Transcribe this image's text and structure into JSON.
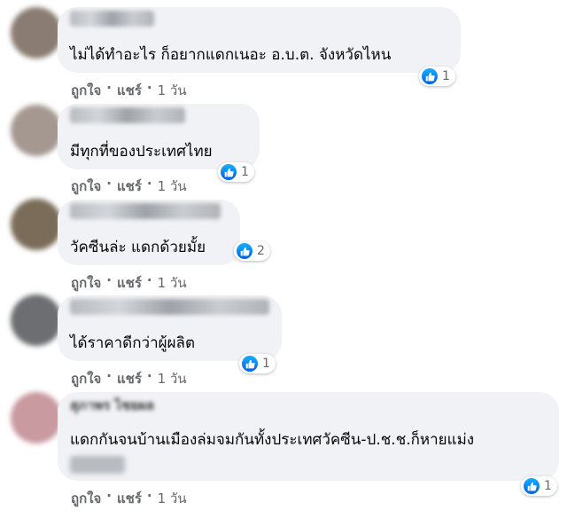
{
  "actions": {
    "like": "ถูกใจ",
    "share": "แชร์",
    "sep": "·"
  },
  "comments": [
    {
      "text": "ไม่ได้ทำอะไร ก็อยากแดกเนอะ อ.บ.ต. จังหวัดไหน",
      "reactions": "1",
      "time": "1 วัน",
      "avatar_color": "#8a7c72"
    },
    {
      "text": "มีทุกที่ของประเทศไทย",
      "reactions": "1",
      "time": "1 วัน",
      "avatar_color": "#a59890"
    },
    {
      "text": "วัคซีนล่ะ แดกด้วยมั้ย",
      "reactions": "2",
      "time": "1 วัน",
      "avatar_color": "#7a6c58"
    },
    {
      "text": "ได้ราคาดีกว่าผู้ผลิต",
      "reactions": "1",
      "time": "1 วัน",
      "avatar_color": "#6d6e72"
    },
    {
      "author": "สุภาพร ไชยผล",
      "text": "แดกกันจนบ้านเมืองล่มจมกันทั้งประเทศวัคซีน-ป.ช.ช.ก็หายแม่ง",
      "reactions": "1",
      "time": "1 วัน",
      "avatar_color": "#c99aa0"
    }
  ]
}
